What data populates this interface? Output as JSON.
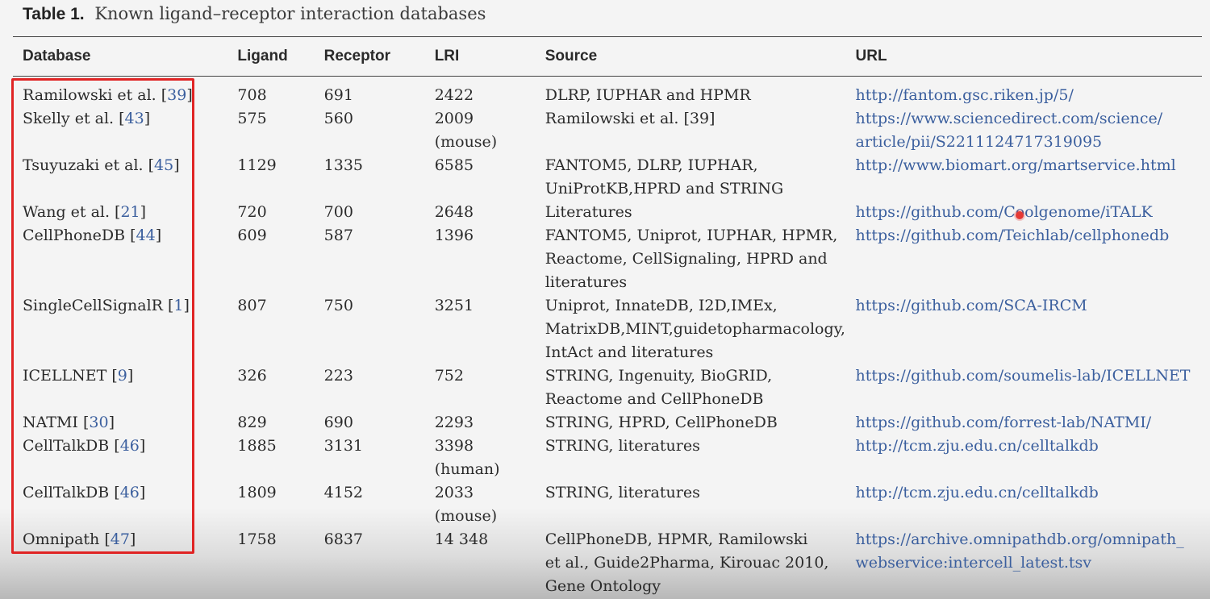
{
  "caption": {
    "label": "Table 1.",
    "title": "Known ligand–receptor interaction databases"
  },
  "columns": [
    "Database",
    "Ligand",
    "Receptor",
    "LRI",
    "Source",
    "URL"
  ],
  "rows": [
    {
      "name": "Ramilowski et al.",
      "ref": "39",
      "ligand": "708",
      "receptor": "691",
      "lri": "2422",
      "source": "DLRP, IUPHAR and HPMR",
      "url": "http://fantom.gsc.riken.jp/5/"
    },
    {
      "name": "Skelly et al.",
      "ref": "43",
      "ligand": "575",
      "receptor": "560",
      "lri": "2009\n(mouse)",
      "source": "Ramilowski et al. [39]",
      "url": "https://www.sciencedirect.com/science/\narticle/pii/S2211124717319095"
    },
    {
      "name": "Tsuyuzaki et al.",
      "ref": "45",
      "ligand": "1129",
      "receptor": "1335",
      "lri": "6585",
      "source": "FANTOM5, DLRP, IUPHAR,\nUniProtKB,HPRD and STRING",
      "url": "http://www.biomart.org/martservice.html"
    },
    {
      "name": "Wang et al.",
      "ref": "21",
      "ligand": "720",
      "receptor": "700",
      "lri": "2648",
      "source": "Literatures",
      "url": "https://github.com/Coolgenome/iTALK"
    },
    {
      "name": "CellPhoneDB",
      "ref": "44",
      "ligand": "609",
      "receptor": "587",
      "lri": "1396",
      "source": "FANTOM5, Uniprot, IUPHAR, HPMR,\nReactome, CellSignaling, HPRD and\nliteratures",
      "url": "https://github.com/Teichlab/cellphonedb"
    },
    {
      "name": "SingleCellSignalR",
      "ref": "1",
      "ligand": "807",
      "receptor": "750",
      "lri": "3251",
      "source": "Uniprot, InnateDB, I2D,IMEx,\nMatrixDB,MINT,guidetopharmacology,\nIntAct and literatures",
      "url": "https://github.com/SCA-IRCM"
    },
    {
      "name": "ICELLNET",
      "ref": "9",
      "ligand": "326",
      "receptor": "223",
      "lri": "752",
      "source": "STRING, Ingenuity, BioGRID,\nReactome and CellPhoneDB",
      "url": "https://github.com/soumelis-lab/ICELLNET"
    },
    {
      "name": "NATMI",
      "ref": "30",
      "ligand": "829",
      "receptor": "690",
      "lri": "2293",
      "source": "STRING, HPRD, CellPhoneDB",
      "url": "https://github.com/forrest-lab/NATMI/"
    },
    {
      "name": "CellTalkDB",
      "ref": "46",
      "ligand": "1885",
      "receptor": "3131",
      "lri": "3398\n(human)",
      "source": "STRING, literatures",
      "url": "http://tcm.zju.edu.cn/celltalkdb"
    },
    {
      "name": "CellTalkDB",
      "ref": "46",
      "ligand": "1809",
      "receptor": "4152",
      "lri": "2033\n(mouse)",
      "source": "STRING, literatures",
      "url": "http://tcm.zju.edu.cn/celltalkdb"
    },
    {
      "name": "Omnipath",
      "ref": "47",
      "ligand": "1758",
      "receptor": "6837",
      "lri": "14 348",
      "source": "CellPhoneDB, HPMR, Ramilowski\net al., Guide2Pharma, Kirouac 2010,\nGene Ontology",
      "url": "https://archive.omnipathdb.org/omnipath_\nwebservice:intercell_latest.tsv"
    }
  ],
  "colors": {
    "highlight_box": "#e02424",
    "link": "#3b5f9e",
    "cursor_dot": "#e53935"
  }
}
